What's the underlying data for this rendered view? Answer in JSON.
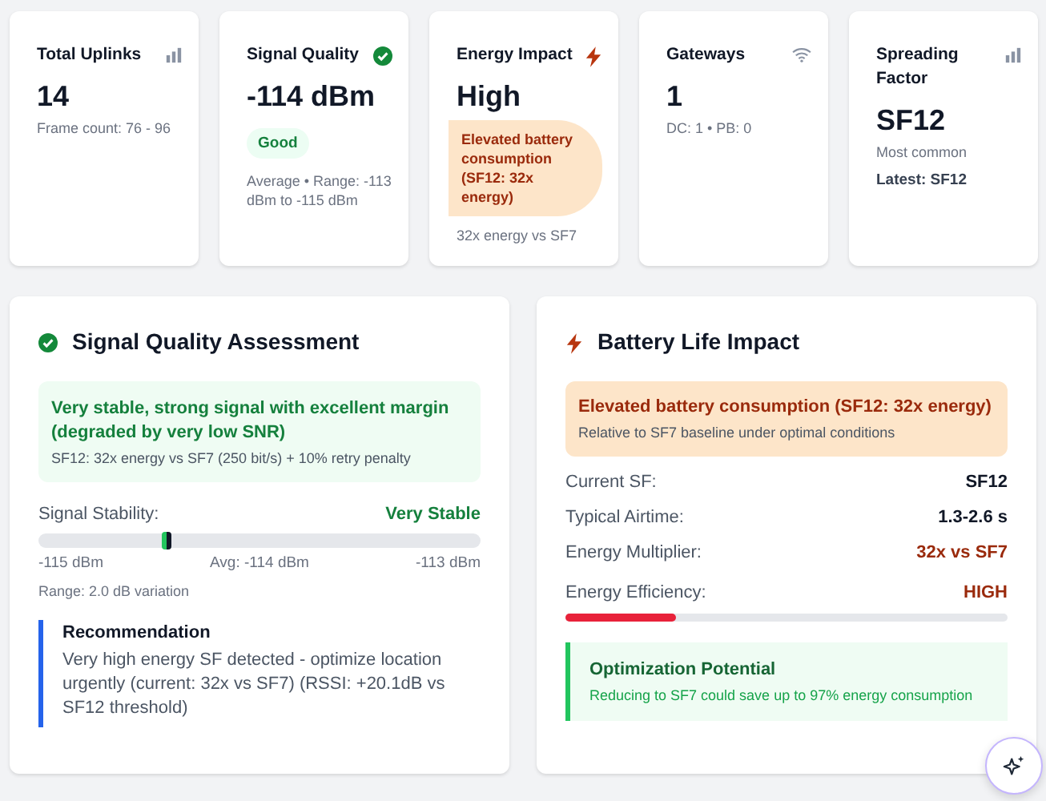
{
  "stat_cards": [
    {
      "title": "Total Uplinks",
      "value": "14",
      "lines": [
        {
          "kind": "muted",
          "text": "Frame count: 76 - 96"
        }
      ]
    },
    {
      "title": "Signal Quality",
      "value": "-114 dBm",
      "lines": [
        {
          "kind": "good-pill",
          "text": "Good"
        },
        {
          "kind": "muted",
          "text": "Average • Range: -113 dBm to -115 dBm"
        }
      ]
    },
    {
      "title": "Energy Impact",
      "value": "High",
      "lines": [
        {
          "kind": "warn-pill",
          "text": "Elevated battery consumption (SF12: 32x energy)"
        },
        {
          "kind": "muted",
          "text": "32x energy vs SF7"
        }
      ]
    },
    {
      "title": "Gateways",
      "value": "1",
      "lines": [
        {
          "kind": "muted",
          "text": "DC: 1 • PB: 0"
        }
      ]
    },
    {
      "title": "Spreading Factor",
      "value": "SF12",
      "lines": [
        {
          "kind": "muted",
          "text": "Most common"
        },
        {
          "kind": "strong",
          "text": "Latest: SF12"
        }
      ]
    }
  ],
  "signal_panel": {
    "title": "Signal Quality Assessment",
    "summary": {
      "headline": "Very stable, strong signal with excellent margin (degraded by very low SNR)",
      "detail": "SF12: 32x energy vs SF7 (250 bit/s) + 10% retry penalty"
    },
    "stability": {
      "label": "Signal Stability:",
      "reading": "Very Stable",
      "level": 0.29,
      "min": "-115 dBm",
      "avg": "Avg: -114 dBm",
      "max": "-113 dBm",
      "range": "Range: 2.0 dB variation"
    },
    "recommendation": {
      "title": "Recommendation",
      "text": "Very high energy SF detected - optimize location urgently (current: 32x vs SF7) (RSSI: +20.1dB vs SF12 threshold)"
    }
  },
  "battery_panel": {
    "title": "Battery Life Impact",
    "alert": {
      "headline": "Elevated battery consumption (SF12: 32x energy)",
      "detail": "Relative to SF7 baseline under optimal conditions"
    },
    "rows": [
      {
        "label": "Current SF:",
        "value": "SF12",
        "kind": "plain"
      },
      {
        "label": "Typical Airtime:",
        "value": "1.3-2.6 s",
        "kind": "plain"
      },
      {
        "label": "Energy Multiplier:",
        "value": "32x vs SF7",
        "kind": "warn"
      }
    ],
    "efficiency": {
      "label": "Energy Efficiency:",
      "reading": "HIGH",
      "level": 0.25
    },
    "tip": {
      "title": "Optimization Potential",
      "text": "Reducing to SF7 could save up to 97% energy consumption"
    }
  }
}
